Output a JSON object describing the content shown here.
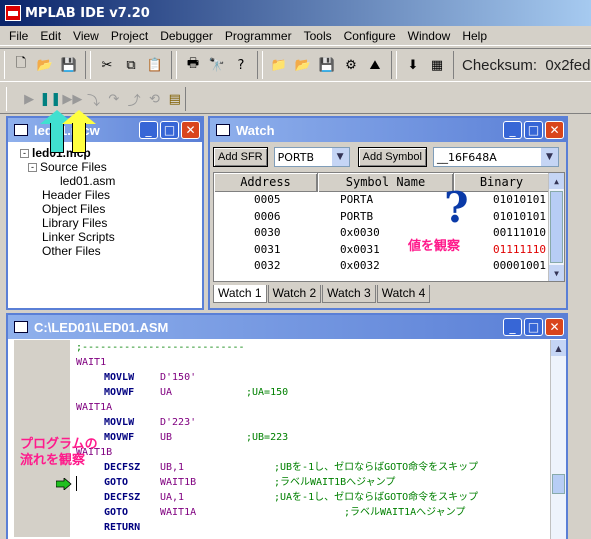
{
  "app": {
    "title": "MPLAB IDE v7.20"
  },
  "menu": [
    "File",
    "Edit",
    "View",
    "Project",
    "Debugger",
    "Programmer",
    "Tools",
    "Configure",
    "Window",
    "Help"
  ],
  "toolbar": {
    "checksum_label": "Checksum:",
    "checksum_value": "0x2fed"
  },
  "project_window": {
    "title": "led01.mcw",
    "tree": [
      {
        "label": "led01.mcp",
        "bold": true,
        "toggle": "-"
      },
      {
        "label": "Source Files",
        "toggle": "-"
      },
      {
        "label": "led01.asm"
      },
      {
        "label": "Header Files"
      },
      {
        "label": "Object Files"
      },
      {
        "label": "Library Files"
      },
      {
        "label": "Linker Scripts"
      },
      {
        "label": "Other Files"
      }
    ]
  },
  "watch_window": {
    "title": "Watch",
    "add_sfr_label": "Add SFR",
    "sfr_select": "PORTB",
    "add_symbol_label": "Add Symbol",
    "symbol_select": "__16F648A",
    "columns": [
      "Address",
      "Symbol Name",
      "Binary"
    ],
    "rows": [
      {
        "address": "0005",
        "symbol": "PORTA",
        "binary": "01010101",
        "changed": false
      },
      {
        "address": "0006",
        "symbol": "PORTB",
        "binary": "01010101",
        "changed": false
      },
      {
        "address": "0030",
        "symbol": "0x0030",
        "binary": "00111010",
        "changed": false
      },
      {
        "address": "0031",
        "symbol": "0x0031",
        "binary": "01111110",
        "changed": true
      },
      {
        "address": "0032",
        "symbol": "0x0032",
        "binary": "00001001",
        "changed": false
      }
    ],
    "tabs": [
      "Watch 1",
      "Watch 2",
      "Watch 3",
      "Watch 4"
    ],
    "active_tab": "Watch 1"
  },
  "editor_window": {
    "title": "C:\\LED01\\LED01.ASM",
    "lines": [
      {
        "label": ";---------------------------",
        "ins": "",
        "op": "",
        "cm": ""
      },
      {
        "label": "WAIT1",
        "ins": "",
        "op": "",
        "cm": ""
      },
      {
        "label": "",
        "ins": "MOVLW",
        "op": "D'150'",
        "cm": ""
      },
      {
        "label": "",
        "ins": "MOVWF",
        "op": "UA",
        "cm": ";UA=150"
      },
      {
        "label": "WAIT1A",
        "ins": "",
        "op": "",
        "cm": ""
      },
      {
        "label": "",
        "ins": "MOVLW",
        "op": "D'223'",
        "cm": ""
      },
      {
        "label": "",
        "ins": "MOVWF",
        "op": "UB",
        "cm": ";UB=223"
      },
      {
        "label": "WAIT1B",
        "ins": "",
        "op": "",
        "cm": ""
      },
      {
        "label": "",
        "ins": "DECFSZ",
        "op": "UB,1",
        "cm": ";UBを-1し、ゼロならばGOTO命令をスキップ"
      },
      {
        "label": "",
        "ins": "GOTO",
        "op": "WAIT1B",
        "cm": ";ラベルWAIT1Bへジャンプ"
      },
      {
        "label": "",
        "ins": "DECFSZ",
        "op": "UA,1",
        "cm": ";UAを-1し、ゼロならばGOTO命令をスキップ"
      },
      {
        "label": "",
        "ins": "GOTO",
        "op": "WAIT1A",
        "cm": ";ラベルWAIT1Aへジャンプ"
      },
      {
        "label": "",
        "ins": "RETURN",
        "op": "",
        "cm": ""
      }
    ]
  },
  "annotations": {
    "watch_note": "値を観察",
    "flow_note_1": "プログラムの",
    "flow_note_2": "流れを観察"
  },
  "colors": {
    "annotation": "#ff1a8c",
    "changed_value": "#e00000",
    "titlebar": "#5a7fd6"
  }
}
